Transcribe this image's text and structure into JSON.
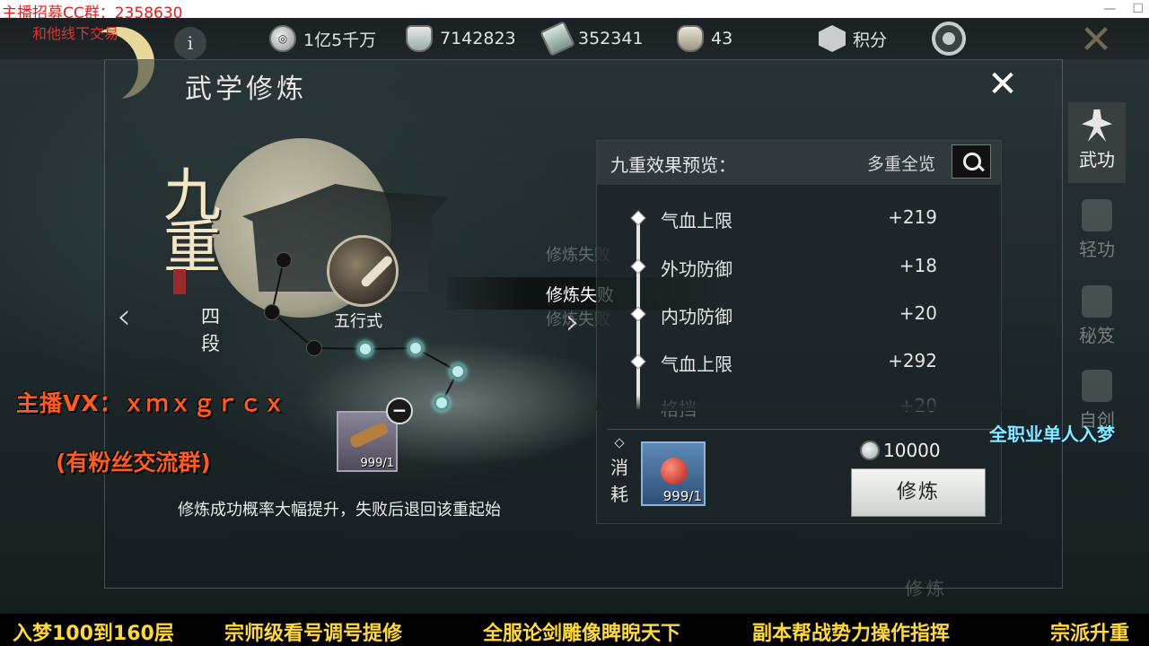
{
  "overlay": {
    "recruit": "主播招募CC群：2358630",
    "trade": "和他线下交易",
    "vx": "主播VX：ｘｍｘｇｒｃｘ",
    "fans": "(有粉丝交流群)",
    "right_promo": "全职业单人入梦",
    "ticker": [
      "入梦100到160层",
      "宗师级看号调号提修",
      "全服论剑雕像睥睨天下",
      "副本帮战势力操作指挥",
      "宗派升重"
    ]
  },
  "resources": [
    {
      "icon": "coin-icon",
      "value": "1亿5千万"
    },
    {
      "icon": "silver-icon",
      "value": "7142823"
    },
    {
      "icon": "jade-icon",
      "value": "352341"
    },
    {
      "icon": "ingot-icon",
      "value": "43"
    }
  ],
  "score_label": "积分",
  "info_label": "i",
  "panel": {
    "title": "武学修炼",
    "stage_big": "九重",
    "stage_sub": "四段",
    "skill_name": "五行式",
    "item_qty": "999/1",
    "hint": "修炼成功概率大幅提升，失败后退回该重起始",
    "fail_text": "修炼失败",
    "fail_ghost_1": "修炼失败",
    "fail_ghost_2": "修炼失败"
  },
  "preview": {
    "title": "九重效果预览：",
    "view_all": "多重全览",
    "stats": [
      {
        "name": "气血上限",
        "value": "+219"
      },
      {
        "name": "外功防御",
        "value": "+18"
      },
      {
        "name": "内功防御",
        "value": "+20"
      },
      {
        "name": "气血上限",
        "value": "+292"
      },
      {
        "name": "格挡",
        "value": "+20"
      }
    ],
    "consume_label": "消耗",
    "consume_qty": "999/1",
    "cost": "10000",
    "cultivate_label": "修炼"
  },
  "side_tabs": [
    {
      "label": "武功",
      "icon": "martial-arts-icon",
      "active": true
    },
    {
      "label": "轻功",
      "icon": "lightness-skill-icon",
      "active": false
    },
    {
      "label": "秘笈",
      "icon": "secret-manual-icon",
      "active": false
    },
    {
      "label": "自创",
      "icon": "self-create-icon",
      "active": false
    }
  ],
  "watermark": "修炼"
}
